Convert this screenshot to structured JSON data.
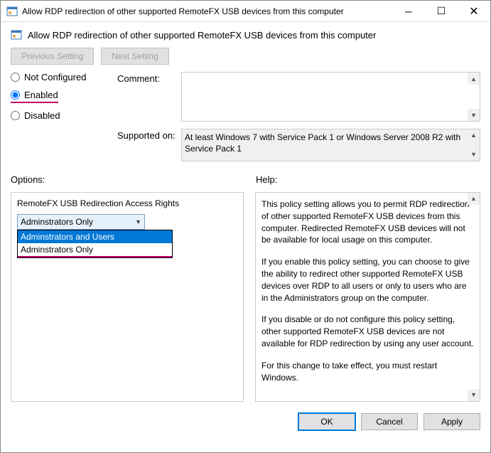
{
  "window": {
    "title": "Allow RDP redirection of other supported RemoteFX USB devices from this computer"
  },
  "header": {
    "label": "Allow RDP redirection of other supported RemoteFX USB devices from this computer"
  },
  "nav": {
    "previous": "Previous Setting",
    "next": "Next Setting"
  },
  "radio": {
    "not_configured": "Not Configured",
    "enabled": "Enabled",
    "disabled": "Disabled"
  },
  "fields": {
    "comment_label": "Comment:",
    "comment_value": "",
    "supported_label": "Supported on:",
    "supported_value": "At least Windows 7 with Service Pack 1 or Windows Server 2008 R2 with Service Pack 1"
  },
  "sections": {
    "options": "Options:",
    "help": "Help:"
  },
  "options": {
    "title": "RemoteFX USB Redirection Access Rights",
    "combo_value": "Adminstrators Only",
    "dropdown": [
      "Adminstrators and Users",
      "Adminstrators Only"
    ]
  },
  "help": {
    "p1": "This policy setting allows you to permit RDP redirection of other supported RemoteFX USB devices from this computer. Redirected RemoteFX USB devices will not be available for local usage on this computer.",
    "p2": "If you enable this policy setting, you can choose to give the ability to redirect other supported RemoteFX USB devices over RDP to all users or only to users who are in the Administrators group on the computer.",
    "p3": "If you disable or do not configure this policy setting, other supported RemoteFX USB devices are not available for RDP redirection by using any user account.",
    "p4": "For this change to take effect, you must restart Windows."
  },
  "buttons": {
    "ok": "OK",
    "cancel": "Cancel",
    "apply": "Apply"
  }
}
